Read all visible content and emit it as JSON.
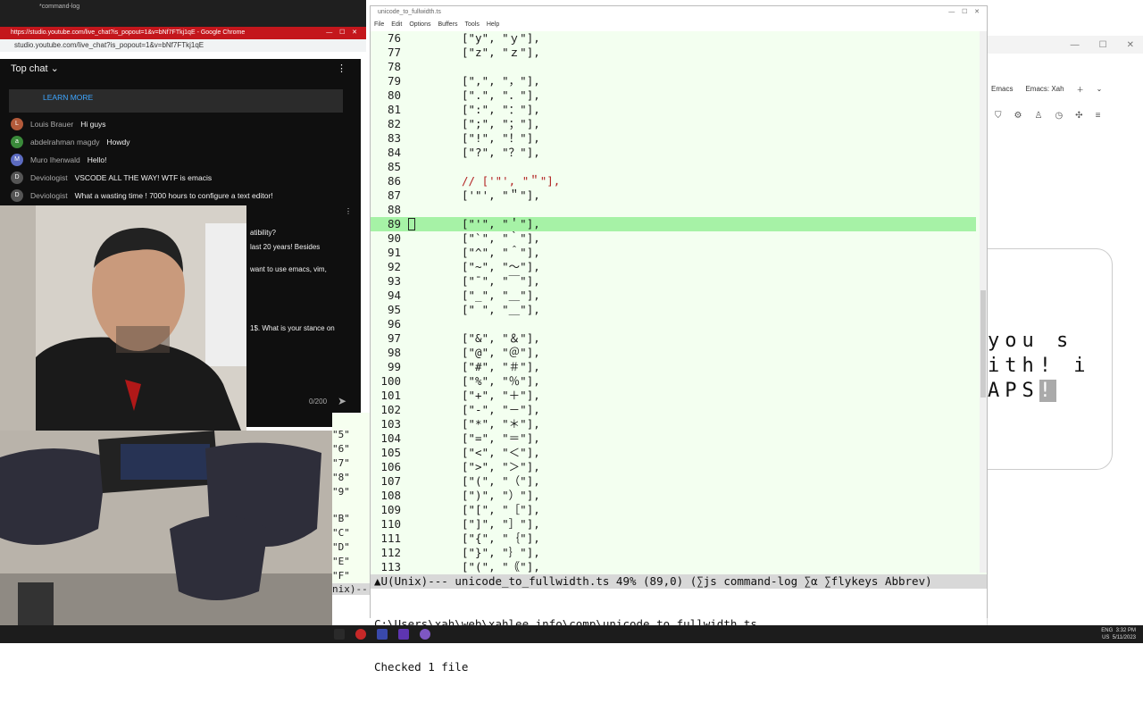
{
  "youtube": {
    "tab_title": "*command-log",
    "window_title": "https://studio.youtube.com/live_chat?is_popout=1&v=bNf7FTkj1qE - Google Chrome",
    "url": "studio.youtube.com/live_chat?is_popout=1&v=bNf7FTkj1qE",
    "chat_mode": "Top chat",
    "learn_more": "LEARN MORE",
    "messages": [
      {
        "author": "Louis Brauer",
        "text": "Hi guys",
        "initial": "L",
        "color": "#b35a3a"
      },
      {
        "author": "abdelrahman magdy",
        "text": "Howdy",
        "initial": "a",
        "color": "#3a8a3a"
      },
      {
        "author": "Muro Ihenwald",
        "text": "Hello!",
        "initial": "M",
        "color": "#5c6bc0"
      },
      {
        "author": "Deviologist",
        "text": "VSCODE ALL THE WAY! WTF is emacis",
        "initial": "D",
        "color": "#555555"
      },
      {
        "author": "Deviologist",
        "text": "What a wasting time ! 7000 hours to configure a text editor!",
        "initial": "D",
        "color": "#555555"
      }
    ],
    "side_fragments": [
      "atibility?",
      "last 20 years! Besides",
      "want to use emacs, vim,",
      "1$. What is your stance on"
    ],
    "char_count": "0/200"
  },
  "strip_lines": [
    "\"5\"",
    "\"6\"",
    "\"7\"",
    "\"8\"",
    "\"9\"",
    "",
    "\"B\"",
    "\"C\"",
    "\"D\"",
    "\"E\"",
    "\"F\""
  ],
  "emacs": {
    "title": "unicode_to_fullwidth.ts",
    "menu": [
      "File",
      "Edit",
      "Options",
      "Tools",
      "Buffers",
      "Help"
    ],
    "lines": [
      {
        "n": "76",
        "t": "[\"y\", \"ｙ\"],"
      },
      {
        "n": "77",
        "t": "[\"z\", \"ｚ\"],"
      },
      {
        "n": "78",
        "t": ""
      },
      {
        "n": "79",
        "t": "[\",\", \"，\"],"
      },
      {
        "n": "80",
        "t": "[\".\", \"．\"],"
      },
      {
        "n": "81",
        "t": "[\":\", \"：\"],"
      },
      {
        "n": "82",
        "t": "[\";\", \"；\"],"
      },
      {
        "n": "83",
        "t": "[\"!\", \"！\"],"
      },
      {
        "n": "84",
        "t": "[\"?\", \"？\"],"
      },
      {
        "n": "85",
        "t": ""
      },
      {
        "n": "86",
        "t": "// ['\"', \"＂\"],",
        "comment": true
      },
      {
        "n": "87",
        "t": "['\"', \"＂\"],"
      },
      {
        "n": "88",
        "t": ""
      },
      {
        "n": "89",
        "t": "[\"'\", \"＇\"],",
        "current": true
      },
      {
        "n": "90",
        "t": "[\"`\", \"｀\"],"
      },
      {
        "n": "91",
        "t": "[\"^\", \"＾\"],"
      },
      {
        "n": "92",
        "t": "[\"~\", \"～\"],"
      },
      {
        "n": "93",
        "t": "[\"¯\", \"￣\"],"
      },
      {
        "n": "94",
        "t": "[\"_\", \"＿\"],"
      },
      {
        "n": "95",
        "t": "[\" \", \"＿\"],"
      },
      {
        "n": "96",
        "t": ""
      },
      {
        "n": "97",
        "t": "[\"&\", \"＆\"],"
      },
      {
        "n": "98",
        "t": "[\"@\", \"＠\"],"
      },
      {
        "n": "99",
        "t": "[\"#\", \"＃\"],"
      },
      {
        "n": "100",
        "t": "[\"%\", \"％\"],"
      },
      {
        "n": "101",
        "t": "[\"+\", \"＋\"],"
      },
      {
        "n": "102",
        "t": "[\"-\", \"－\"],"
      },
      {
        "n": "103",
        "t": "[\"*\", \"＊\"],"
      },
      {
        "n": "104",
        "t": "[\"=\", \"＝\"],"
      },
      {
        "n": "105",
        "t": "[\"<\", \"＜\"],"
      },
      {
        "n": "106",
        "t": "[\">\", \"＞\"],"
      },
      {
        "n": "107",
        "t": "[\"(\", \"（\"],"
      },
      {
        "n": "108",
        "t": "[\")\", \"）\"],"
      },
      {
        "n": "109",
        "t": "[\"[\", \"［\"],"
      },
      {
        "n": "110",
        "t": "[\"]\", \"］\"],"
      },
      {
        "n": "111",
        "t": "[\"{\", \"｛\"],"
      },
      {
        "n": "112",
        "t": "[\"}\", \"｝\"],"
      },
      {
        "n": "113",
        "t": "[\"(\", \"｟\"],"
      }
    ],
    "modeline": "U(Unix)--- unicode_to_fullwidth.ts 49% (89,0) (∑js command-log ∑α ∑flykeys Abbrev)",
    "minibuffer_path": "C:\\Users\\xah\\web\\xahlee_info\\comp\\unicode_to_fullwidth.ts",
    "minibuffer_msg": "Checked 1 file",
    "left_modeline_fragment": "nix)--"
  },
  "bgwin": {
    "tabs": [
      "Emacs",
      "Emacs: Xah"
    ],
    "big_text": [
      "you s",
      "ith! i",
      "APS"
    ],
    "big_highlight": "!"
  },
  "taskbar": {
    "lang": "ENG",
    "region": "US",
    "time": "3:32 PM",
    "date": "5/11/2023"
  }
}
